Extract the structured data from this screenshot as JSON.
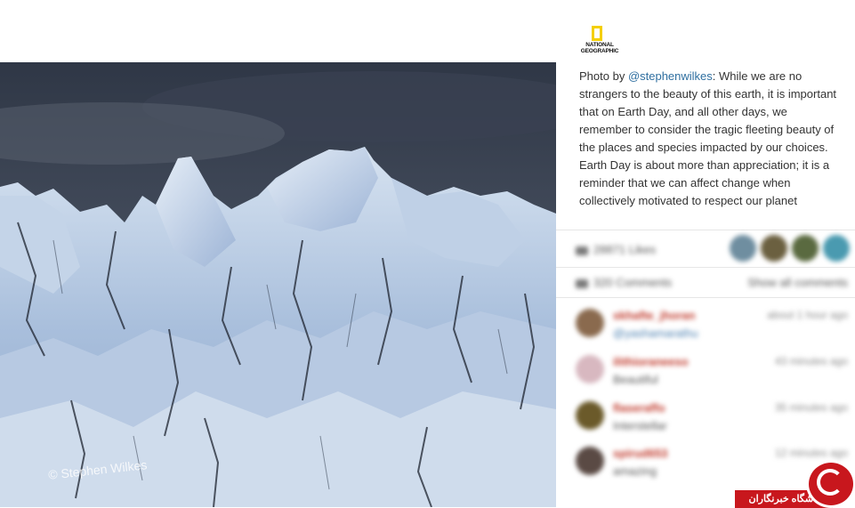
{
  "photo": {
    "watermark": "© Stephen Wilkes"
  },
  "brand": {
    "logo_line1": "NATIONAL",
    "logo_line2": "GEOGRAPHIC",
    "logo_color": "#f4cf00"
  },
  "caption": {
    "prefix": "Photo by ",
    "handle": "@stephenwilkes",
    "para1_rest": ": While we are no strangers to the beauty of this earth, it is important that on Earth Day, and all other days, we remember to consider the tragic fleeting beauty of the places and species impacted by our choices.",
    "para2": "Earth Day is about more than appreciation; it is a reminder that we can affect change when collectively motivated to respect our planet"
  },
  "stats": {
    "likes": "28871 Likes",
    "comments": "320 Comments",
    "show_all": "Show all comments"
  },
  "comments": [
    {
      "user": "skhafte_jhoran",
      "text": "@yashamarathu",
      "time": "about 1 hour ago",
      "avatar_color": "#8a6a4e"
    },
    {
      "user": "ilithioraneeso",
      "text": "Beautiful",
      "time": "43 minutes ago",
      "avatar_color": "#d8b8c0"
    },
    {
      "user": "flaseraffo",
      "text": "Interstellar",
      "time": "35 minutes ago",
      "avatar_color": "#6b5a2a"
    },
    {
      "user": "spirud653",
      "text": "amazing",
      "time": "12 minutes ago",
      "avatar_color": "#5a4a44"
    }
  ],
  "likers": [
    "#6f8ea0",
    "#6b6040",
    "#5a6a40",
    "#4a9ab0"
  ],
  "badge": {
    "text": "باشگاه خبرنگاران",
    "color": "#c8171d"
  }
}
